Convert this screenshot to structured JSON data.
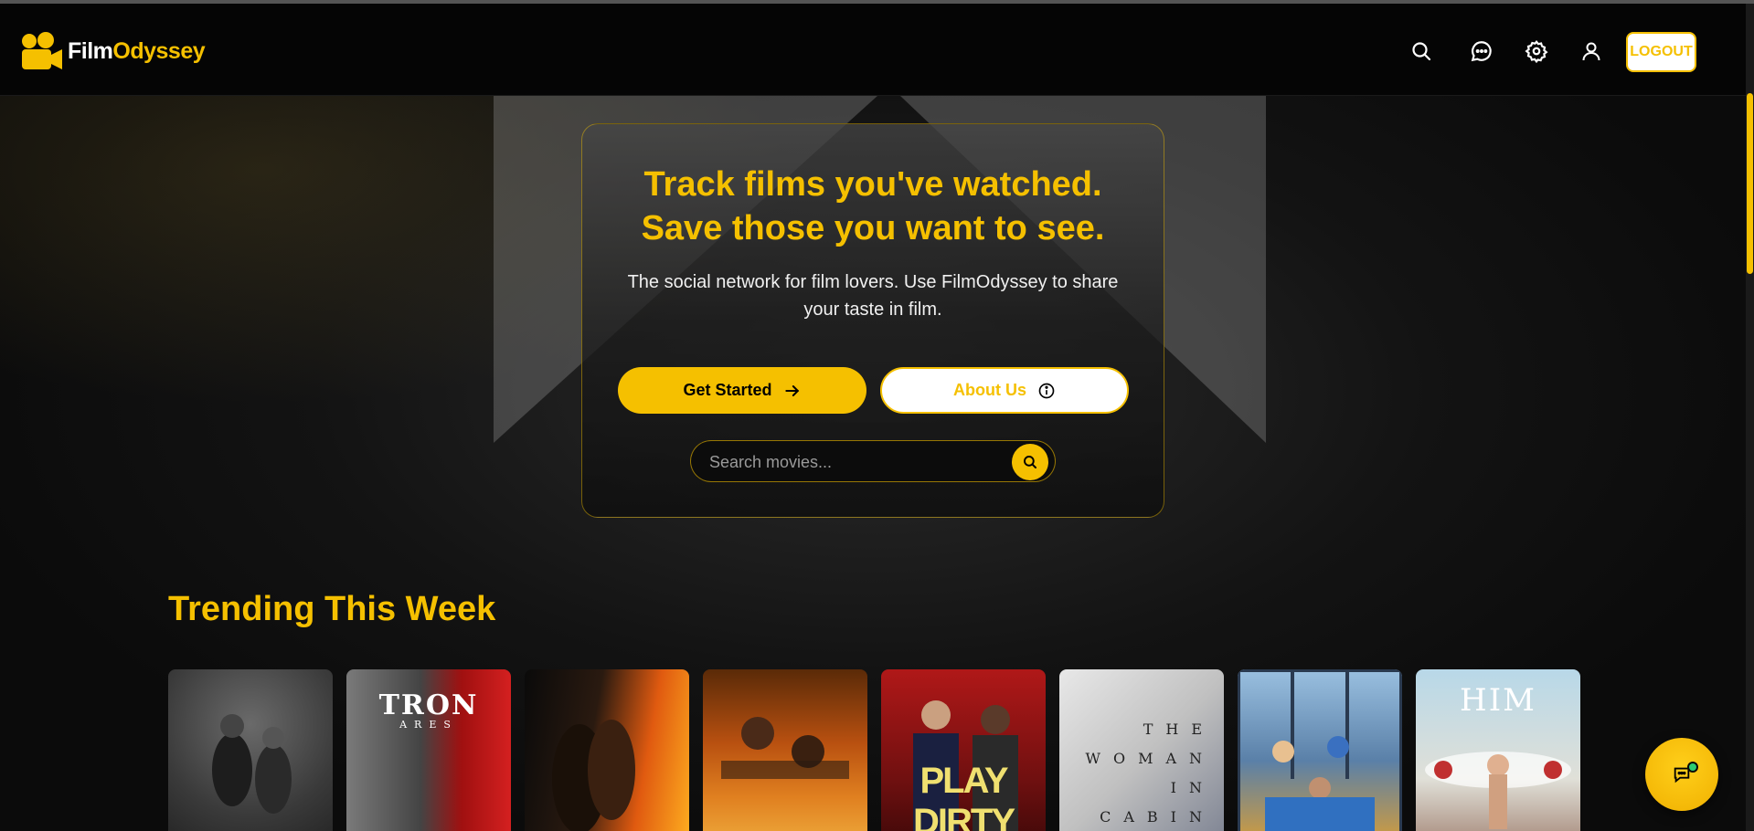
{
  "brand": {
    "name_part1": "Film",
    "name_part2": "Odyssey",
    "accent_color": "#f5c000"
  },
  "header": {
    "icons": [
      "search-icon",
      "chat-icon",
      "gear-icon",
      "user-icon"
    ],
    "logout_label": "LOGOUT"
  },
  "hero": {
    "title_line1": "Track films you've watched.",
    "title_line2": "Save those you want to see.",
    "subtitle": "The social network for film lovers. Use FilmOdyssey to share your taste in film.",
    "get_started_label": "Get Started",
    "about_label": "About Us",
    "search_placeholder": "Search movies..."
  },
  "trending": {
    "title": "Trending This Week",
    "posters": [
      {
        "title_text": ""
      },
      {
        "title_text": "TRON",
        "subtitle_text": "ARES"
      },
      {
        "title_text": ""
      },
      {
        "title_text": ""
      },
      {
        "title_text": "PLAY DIRTY"
      },
      {
        "title_text": "THE WOMAN IN CABIN"
      },
      {
        "title_text": ""
      },
      {
        "title_text": "HIM"
      }
    ]
  }
}
